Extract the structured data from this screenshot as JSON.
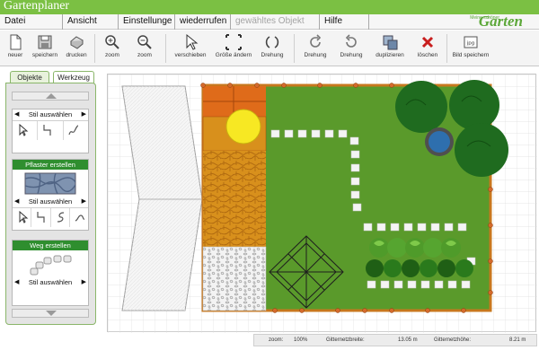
{
  "app": {
    "title": "Gartenplaner",
    "logo": "Garten",
    "logo_prefix": "Meine schöner"
  },
  "menu": [
    {
      "label": "Datei"
    },
    {
      "label": "Ansicht"
    },
    {
      "label": "Einstellunge"
    },
    {
      "label": "wiederrufen"
    },
    {
      "label": "gewähltes Objekt",
      "disabled": true
    },
    {
      "label": "Hilfe"
    }
  ],
  "toolbar": {
    "neuer": "neuer",
    "speichern": "speichern",
    "drucken": "drucken",
    "zoom_in": "zoom",
    "zoom_out": "zoom",
    "verschieben": "verschieben",
    "groesse": "Größe ändern",
    "drehung": "Drehung",
    "drehung_left": "Drehung",
    "drehung_right": "Drehung",
    "duplizieren": "duplizieren",
    "loeschen": "löschen",
    "bild_speichern": "Bild speichern",
    "bild_badge": "jpg"
  },
  "panel": {
    "tabs": [
      {
        "label": "Objekte"
      },
      {
        "label": "Werkzeug",
        "active": true
      }
    ],
    "groups": [
      {
        "title": "",
        "stil": "Stil auswählen"
      },
      {
        "title": "Pflaster erstellen",
        "stil": "Stil auswählen"
      },
      {
        "title": "Weg erstellen",
        "stil": "Stil auswählen"
      }
    ]
  },
  "status": {
    "zoom_label": "zoom:",
    "zoom_value": "100%",
    "width_label": "Gitternetzbreite:",
    "width_value": "13.05 m",
    "height_label": "Gitternetzhöhe:",
    "height_value": "8.21 m"
  },
  "colors": {
    "header_green": "#7bc043",
    "lawn": "#5a9a2b",
    "border_orange": "#c8781e",
    "paving_orange": "#d8901c",
    "tile_orange": "#df6b1a",
    "sun_yellow": "#f7e823",
    "pond_blue": "#2e6fae",
    "tree_green": "#1f6b1f",
    "path_stone": "#f4f4f4"
  }
}
